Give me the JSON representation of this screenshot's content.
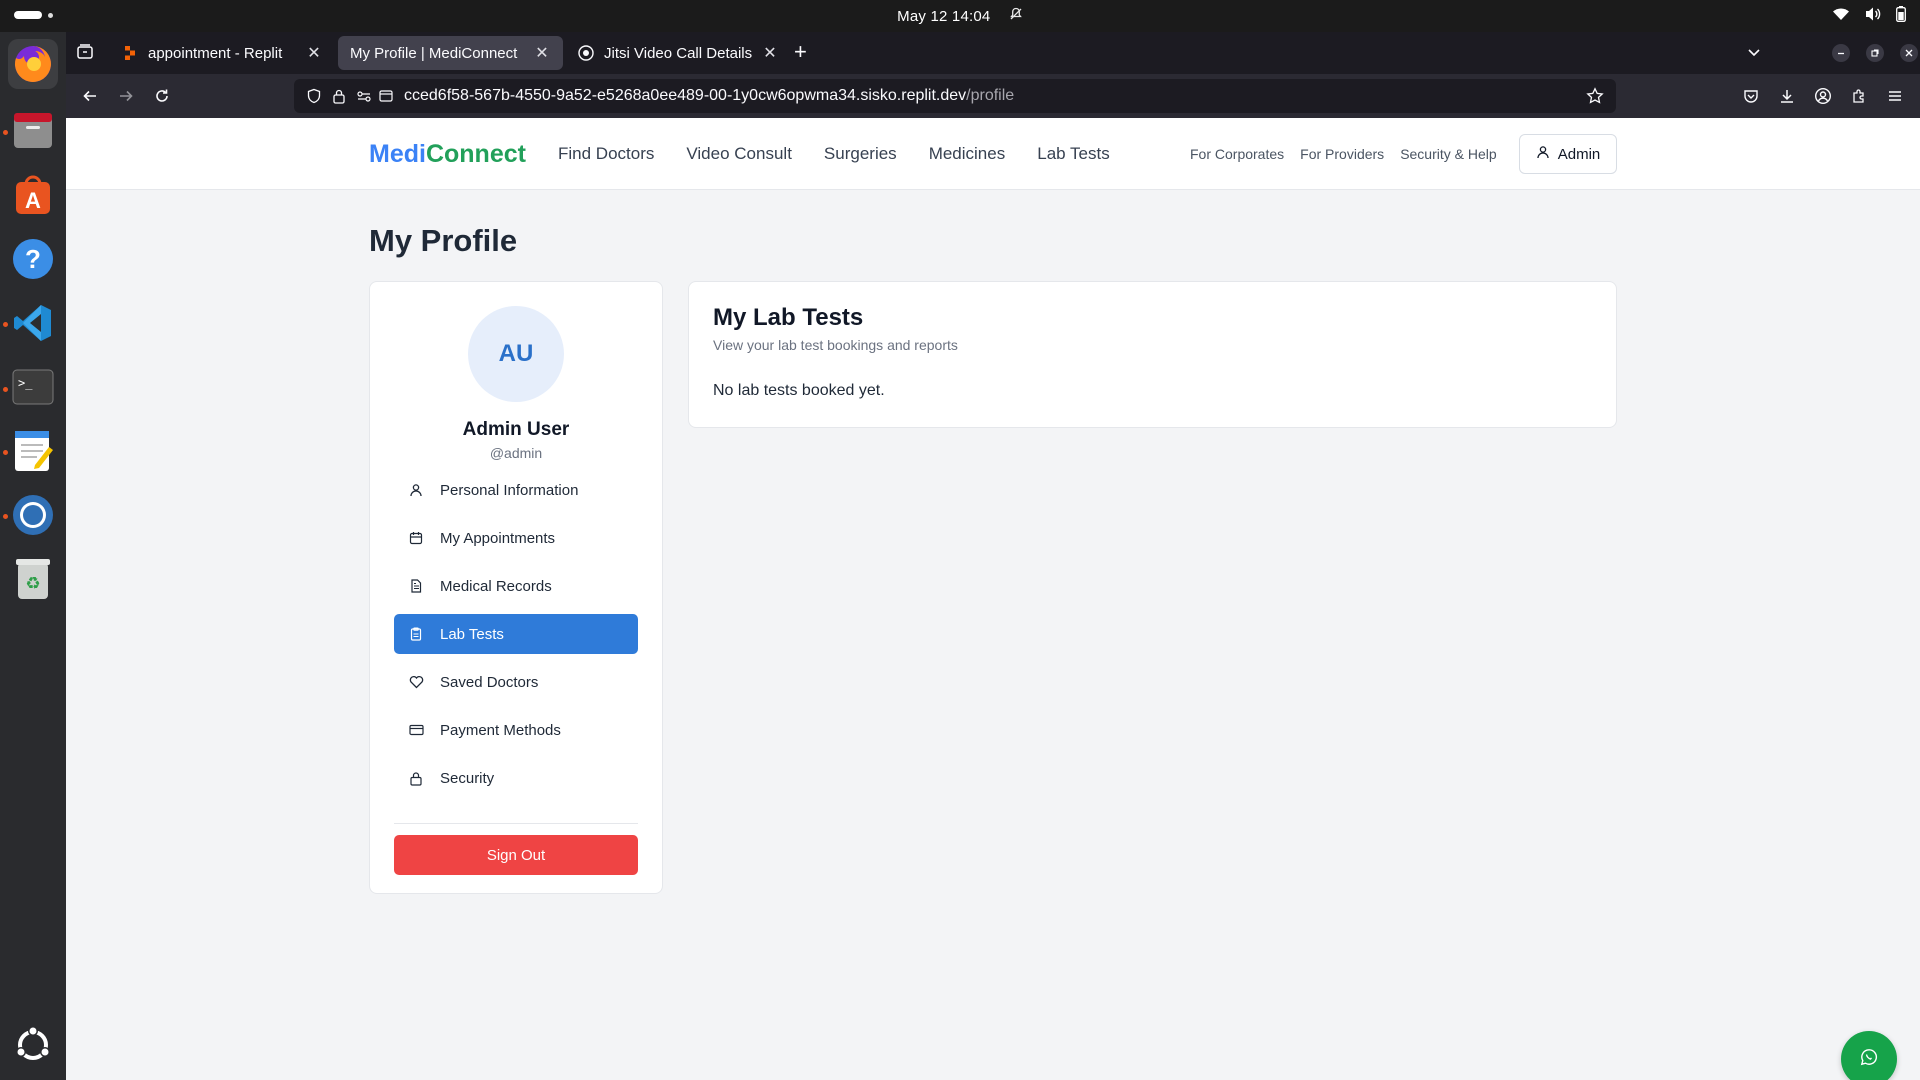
{
  "system": {
    "clock": "May 12  14:04"
  },
  "browser": {
    "tabs": [
      {
        "title": "appointment - Replit"
      },
      {
        "title": "My Profile | MediConnect"
      },
      {
        "title": "Jitsi Video Call Details"
      }
    ],
    "url_host": "cced6f58-567b-4550-9a52-e5268a0ee489-00-1y0cw6opwma34.sisko.replit.dev",
    "url_path": "/profile"
  },
  "site": {
    "logo_part1": "Medi",
    "logo_part2": "Connect",
    "main_nav": [
      "Find Doctors",
      "Video Consult",
      "Surgeries",
      "Medicines",
      "Lab Tests"
    ],
    "secondary_nav": [
      "For Corporates",
      "For Providers",
      "Security & Help"
    ],
    "account_label": "Admin"
  },
  "profile": {
    "page_title": "My Profile",
    "avatar_initials": "AU",
    "name": "Admin User",
    "handle": "@admin",
    "menu": [
      {
        "label": "Personal Information",
        "icon": "user-icon"
      },
      {
        "label": "My Appointments",
        "icon": "calendar-icon"
      },
      {
        "label": "Medical Records",
        "icon": "document-icon"
      },
      {
        "label": "Lab Tests",
        "icon": "clipboard-icon",
        "active": true
      },
      {
        "label": "Saved Doctors",
        "icon": "heart-icon"
      },
      {
        "label": "Payment Methods",
        "icon": "credit-card-icon"
      },
      {
        "label": "Security",
        "icon": "lock-icon"
      }
    ],
    "signout_label": "Sign Out"
  },
  "lab_tests": {
    "title": "My Lab Tests",
    "subtitle": "View your lab test bookings and reports",
    "empty_message": "No lab tests booked yet."
  },
  "colors": {
    "primary": "#2f7bd9",
    "danger": "#ef4444",
    "success": "#16a34a",
    "logo_blue": "#3b82f6",
    "logo_green": "#22a05a"
  }
}
